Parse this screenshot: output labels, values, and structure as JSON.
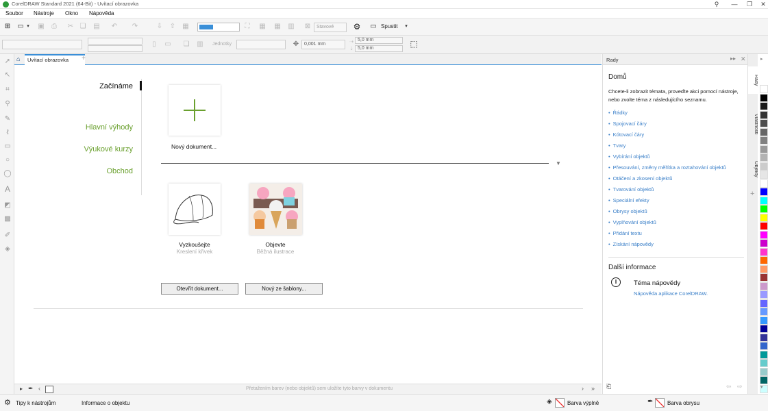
{
  "titlebar": {
    "title": "CorelDRAW Standard 2021 (64-Bit) - Uvítací obrazovka"
  },
  "menubar": {
    "items": [
      "Soubor",
      "Nástroje",
      "Okno",
      "Nápověda"
    ]
  },
  "toolbar1": {
    "launch_label": "Spustit",
    "zoom_placeholder": "Stavové"
  },
  "toolbar2": {
    "nudge": "0,001 mm",
    "dup_x": "5,0 mm",
    "dup_y": "5,0 mm",
    "units": "Jednotky"
  },
  "tab": {
    "label": "Uvítací obrazovka"
  },
  "welcome": {
    "nav": [
      {
        "label": "Začínáme",
        "active": true
      },
      {
        "label": "Hlavní výhody",
        "active": false
      },
      {
        "label": "Výukové kurzy",
        "active": false
      },
      {
        "label": "Obchod",
        "active": false
      }
    ],
    "new_doc_label": "Nový dokument...",
    "cards": [
      {
        "title": "Vyzkoušejte",
        "subtitle": "Kreslení křivek"
      },
      {
        "title": "Objevte",
        "subtitle": "Běžná ilustrace"
      }
    ],
    "open_button": "Otevřít dokument...",
    "template_button": "Nový ze šablony..."
  },
  "statusnav": {
    "hint": "Přetažením barev (nebo objektů) sem uložíte tyto barvy v dokumentu"
  },
  "statusbar": {
    "tips": "Tipy k nástrojům",
    "object_info": "Informace o objektu",
    "fill_label": "Barva výplně",
    "outline_label": "Barva obrysu"
  },
  "panel": {
    "header": "Rady",
    "home_title": "Domů",
    "intro": "Chcete-li zobrazit témata, proveďte akci pomocí nástroje, nebo zvolte téma z následujícího seznamu.",
    "links": [
      "Řádky",
      "Spojovací čáry",
      "Kótovací čáry",
      "Tvary",
      "Vybírání objektů",
      "Přesouvání, změny měřítka a roztahování objektů",
      "Otáčení a zkosení objektů",
      "Tvarování objektů",
      "Speciální efekty",
      "Obrysy objektů",
      "Vyplňování objektů",
      "Přidání textu",
      "Získání nápovědy"
    ],
    "more_title": "Další informace",
    "help_title": "Téma nápovědy",
    "help_link": "Nápověda aplikace CorelDRAW."
  },
  "sidetabs": [
    "Rady",
    "Vlastnosti",
    "Objekty"
  ],
  "palette": {
    "colors": [
      "#ffffff",
      "#000000",
      "#1a1a1a",
      "#333333",
      "#4d4d4d",
      "#666666",
      "#808080",
      "#999999",
      "#b3b3b3",
      "#cccccc",
      "#e6e6e6",
      "#ffffff",
      "#0000ff",
      "#00ffff",
      "#00ff00",
      "#ffff00",
      "#ff0000",
      "#ff00ff",
      "#cc00cc",
      "#ff33cc",
      "#ff6600",
      "#ff9966",
      "#993333",
      "#cc99cc",
      "#9999ff",
      "#6666ff",
      "#6699ff",
      "#3399ff",
      "#000099",
      "#333399",
      "#3366cc",
      "#009999",
      "#66cccc",
      "#99cccc",
      "#006666",
      "#ccffff"
    ]
  },
  "accent": "#3a8fd8",
  "green": "#6aa02e"
}
